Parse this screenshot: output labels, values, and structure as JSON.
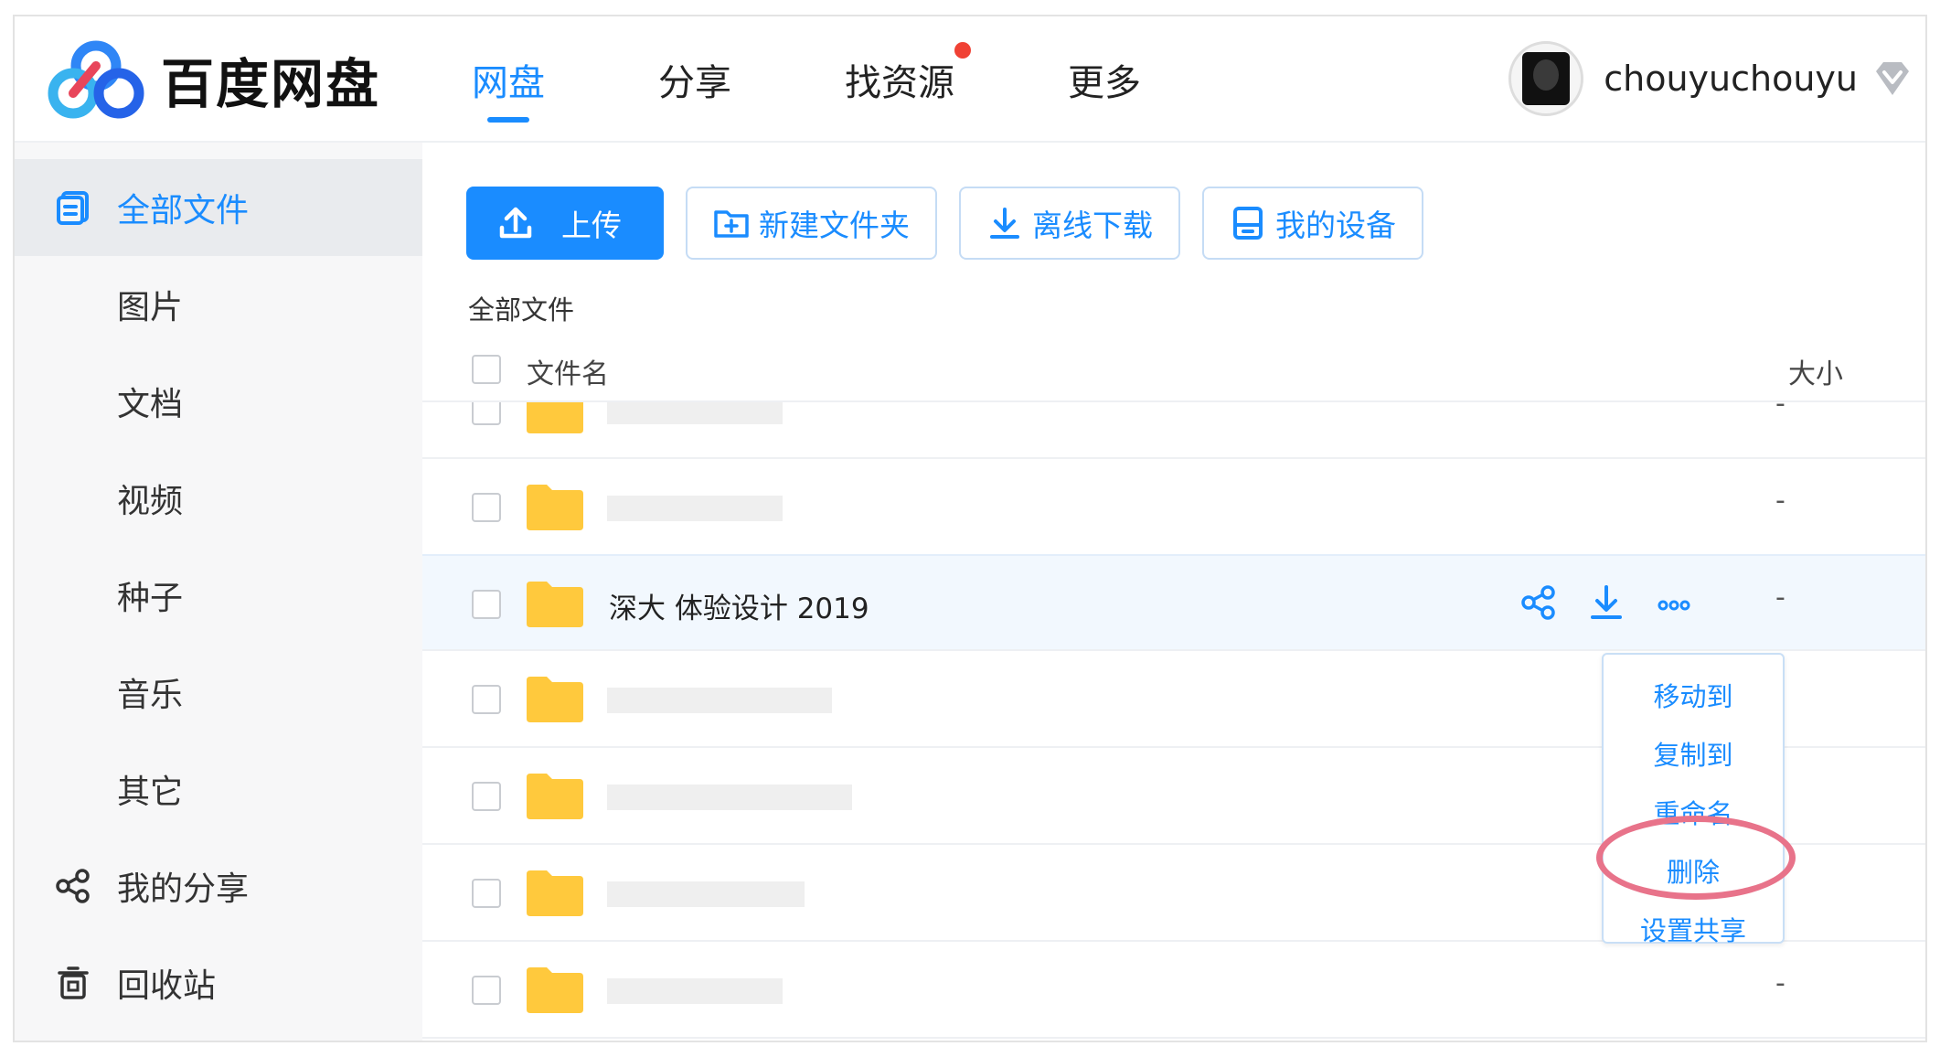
{
  "header": {
    "logo_text": "百度网盘",
    "nav": [
      {
        "label": "网盘",
        "active": true
      },
      {
        "label": "分享",
        "active": false
      },
      {
        "label": "找资源",
        "active": false,
        "badge": true
      },
      {
        "label": "更多",
        "active": false
      }
    ],
    "username": "chouyuchouyu"
  },
  "sidebar": {
    "items": [
      {
        "label": "全部文件",
        "icon": "all-files-icon",
        "active": true
      },
      {
        "label": "图片"
      },
      {
        "label": "文档"
      },
      {
        "label": "视频"
      },
      {
        "label": "种子"
      },
      {
        "label": "音乐"
      },
      {
        "label": "其它"
      },
      {
        "label": "我的分享",
        "icon": "share-icon"
      },
      {
        "label": "回收站",
        "icon": "trash-icon"
      }
    ]
  },
  "toolbar": {
    "upload": "上传",
    "new_folder": "新建文件夹",
    "offline_download": "离线下载",
    "my_devices": "我的设备"
  },
  "breadcrumb": "全部文件",
  "table": {
    "col_name": "文件名",
    "col_size": "大小",
    "rows": [
      {
        "name": "",
        "size": "-"
      },
      {
        "name": "",
        "size": "-"
      },
      {
        "name": "深大 体验设计 2019",
        "size": "-"
      },
      {
        "name": "",
        "size": ""
      },
      {
        "name": "",
        "size": ""
      },
      {
        "name": "",
        "size": ""
      },
      {
        "name": "",
        "size": "-"
      }
    ]
  },
  "context_menu": {
    "items": [
      "移动到",
      "复制到",
      "重命名",
      "删除",
      "设置共享"
    ]
  },
  "colors": {
    "accent": "#1a8cff",
    "folder": "#ffc93d",
    "badge": "#f04134",
    "highlight": "#e8738a"
  }
}
